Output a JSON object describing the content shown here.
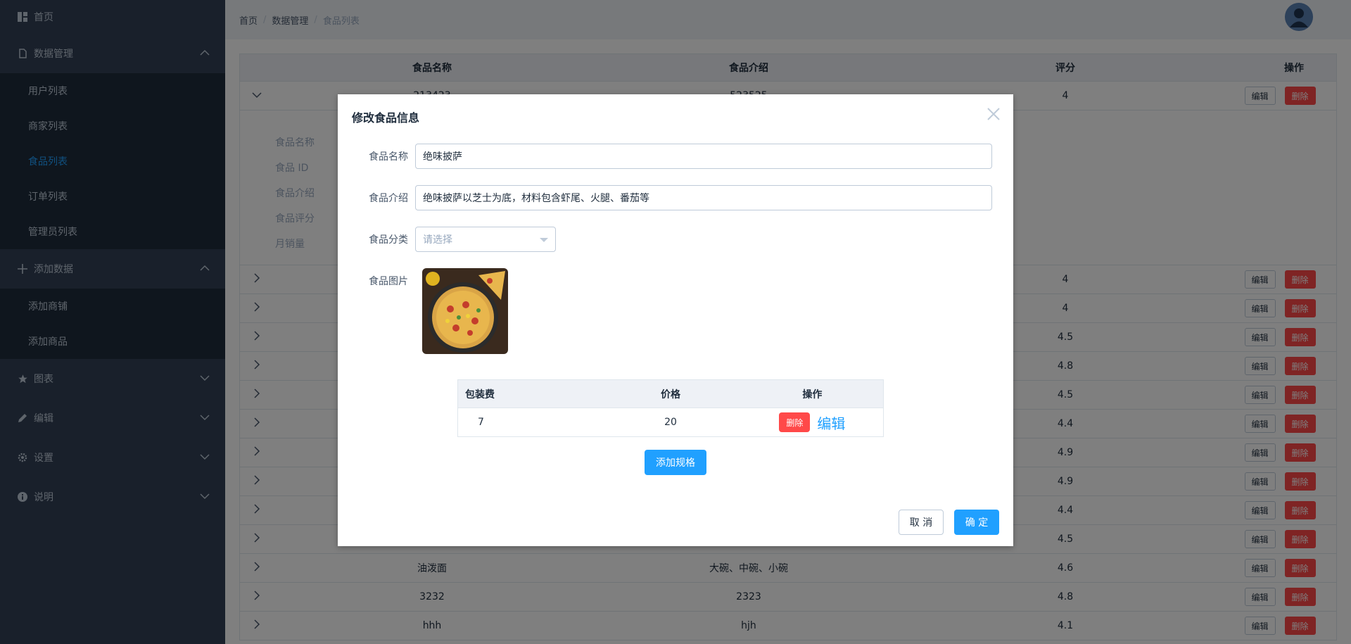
{
  "sidebar": {
    "home": "首页",
    "data_mgmt": "数据管理",
    "data_items": [
      "用户列表",
      "商家列表",
      "食品列表",
      "订单列表",
      "管理员列表"
    ],
    "add_data": "添加数据",
    "add_items": [
      "添加商铺",
      "添加商品"
    ],
    "charts": "图表",
    "edit": "编辑",
    "settings": "设置",
    "about": "说明"
  },
  "breadcrumb": [
    "首页",
    "数据管理",
    "食品列表"
  ],
  "table": {
    "headers": {
      "name": "食品名称",
      "desc": "食品介绍",
      "score": "评分",
      "op": "操作"
    },
    "edit_label": "编辑",
    "delete_label": "删除",
    "first_row": {
      "name": "213423",
      "desc": "523525",
      "score": "4"
    },
    "expand_labels": [
      "食品名称",
      "食品 ID",
      "食品介绍",
      "食品评分",
      "月销量"
    ],
    "rows": [
      {
        "name": "",
        "desc": "",
        "score": "4"
      },
      {
        "name": "",
        "desc": "",
        "score": "4"
      },
      {
        "name": "",
        "desc": "",
        "score": "4.5"
      },
      {
        "name": "",
        "desc": "",
        "score": "4.8"
      },
      {
        "name": "",
        "desc": "",
        "score": "4.5"
      },
      {
        "name": "",
        "desc": "",
        "score": "4.4"
      },
      {
        "name": "",
        "desc": "",
        "score": "4.9"
      },
      {
        "name": "",
        "desc": "",
        "score": "4.9"
      },
      {
        "name": "",
        "desc": "",
        "score": "4.4"
      },
      {
        "name": "",
        "desc": "",
        "score": "4.5"
      },
      {
        "name": "油泼面",
        "desc": "大碗、中碗、小碗",
        "score": "4.6"
      },
      {
        "name": "3232",
        "desc": "2323",
        "score": "4.8"
      },
      {
        "name": "hhh",
        "desc": "hjh",
        "score": "4.1"
      }
    ]
  },
  "dialog": {
    "title": "修改食品信息",
    "name_label": "食品名称",
    "name_value": "绝味披萨",
    "desc_label": "食品介绍",
    "desc_value": "绝味披萨以芝士为底，材料包含虾尾、火腿、番茄等",
    "category_label": "食品分类",
    "category_placeholder": "请选择",
    "image_label": "食品图片",
    "spec_headers": {
      "pack": "包装费",
      "price": "价格",
      "op": "操作"
    },
    "spec_row": {
      "pack": "7",
      "price": "20",
      "delete": "删除",
      "edit": "编辑"
    },
    "add_spec": "添加规格",
    "cancel": "取 消",
    "confirm": "确 定"
  },
  "colors": {
    "sidebar_bg": "#324157",
    "submenu_bg": "#1f2d3d",
    "primary": "#20a0ff",
    "danger": "#ff4949"
  }
}
